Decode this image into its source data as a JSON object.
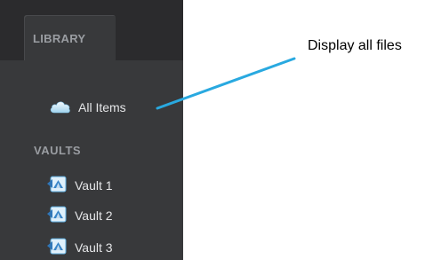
{
  "sidebar": {
    "library_tab": "LIBRARY",
    "all_items": {
      "label": "All Items",
      "icon": "cloud-icon"
    },
    "vaults_heading": "VAULTS",
    "vaults": [
      {
        "label": "Vault 1",
        "icon": "vault-icon"
      },
      {
        "label": "Vault 2",
        "icon": "vault-icon"
      },
      {
        "label": "Vault 3",
        "icon": "vault-icon"
      }
    ]
  },
  "annotation": {
    "text": "Display all files",
    "line_color": "#29a9e0"
  }
}
